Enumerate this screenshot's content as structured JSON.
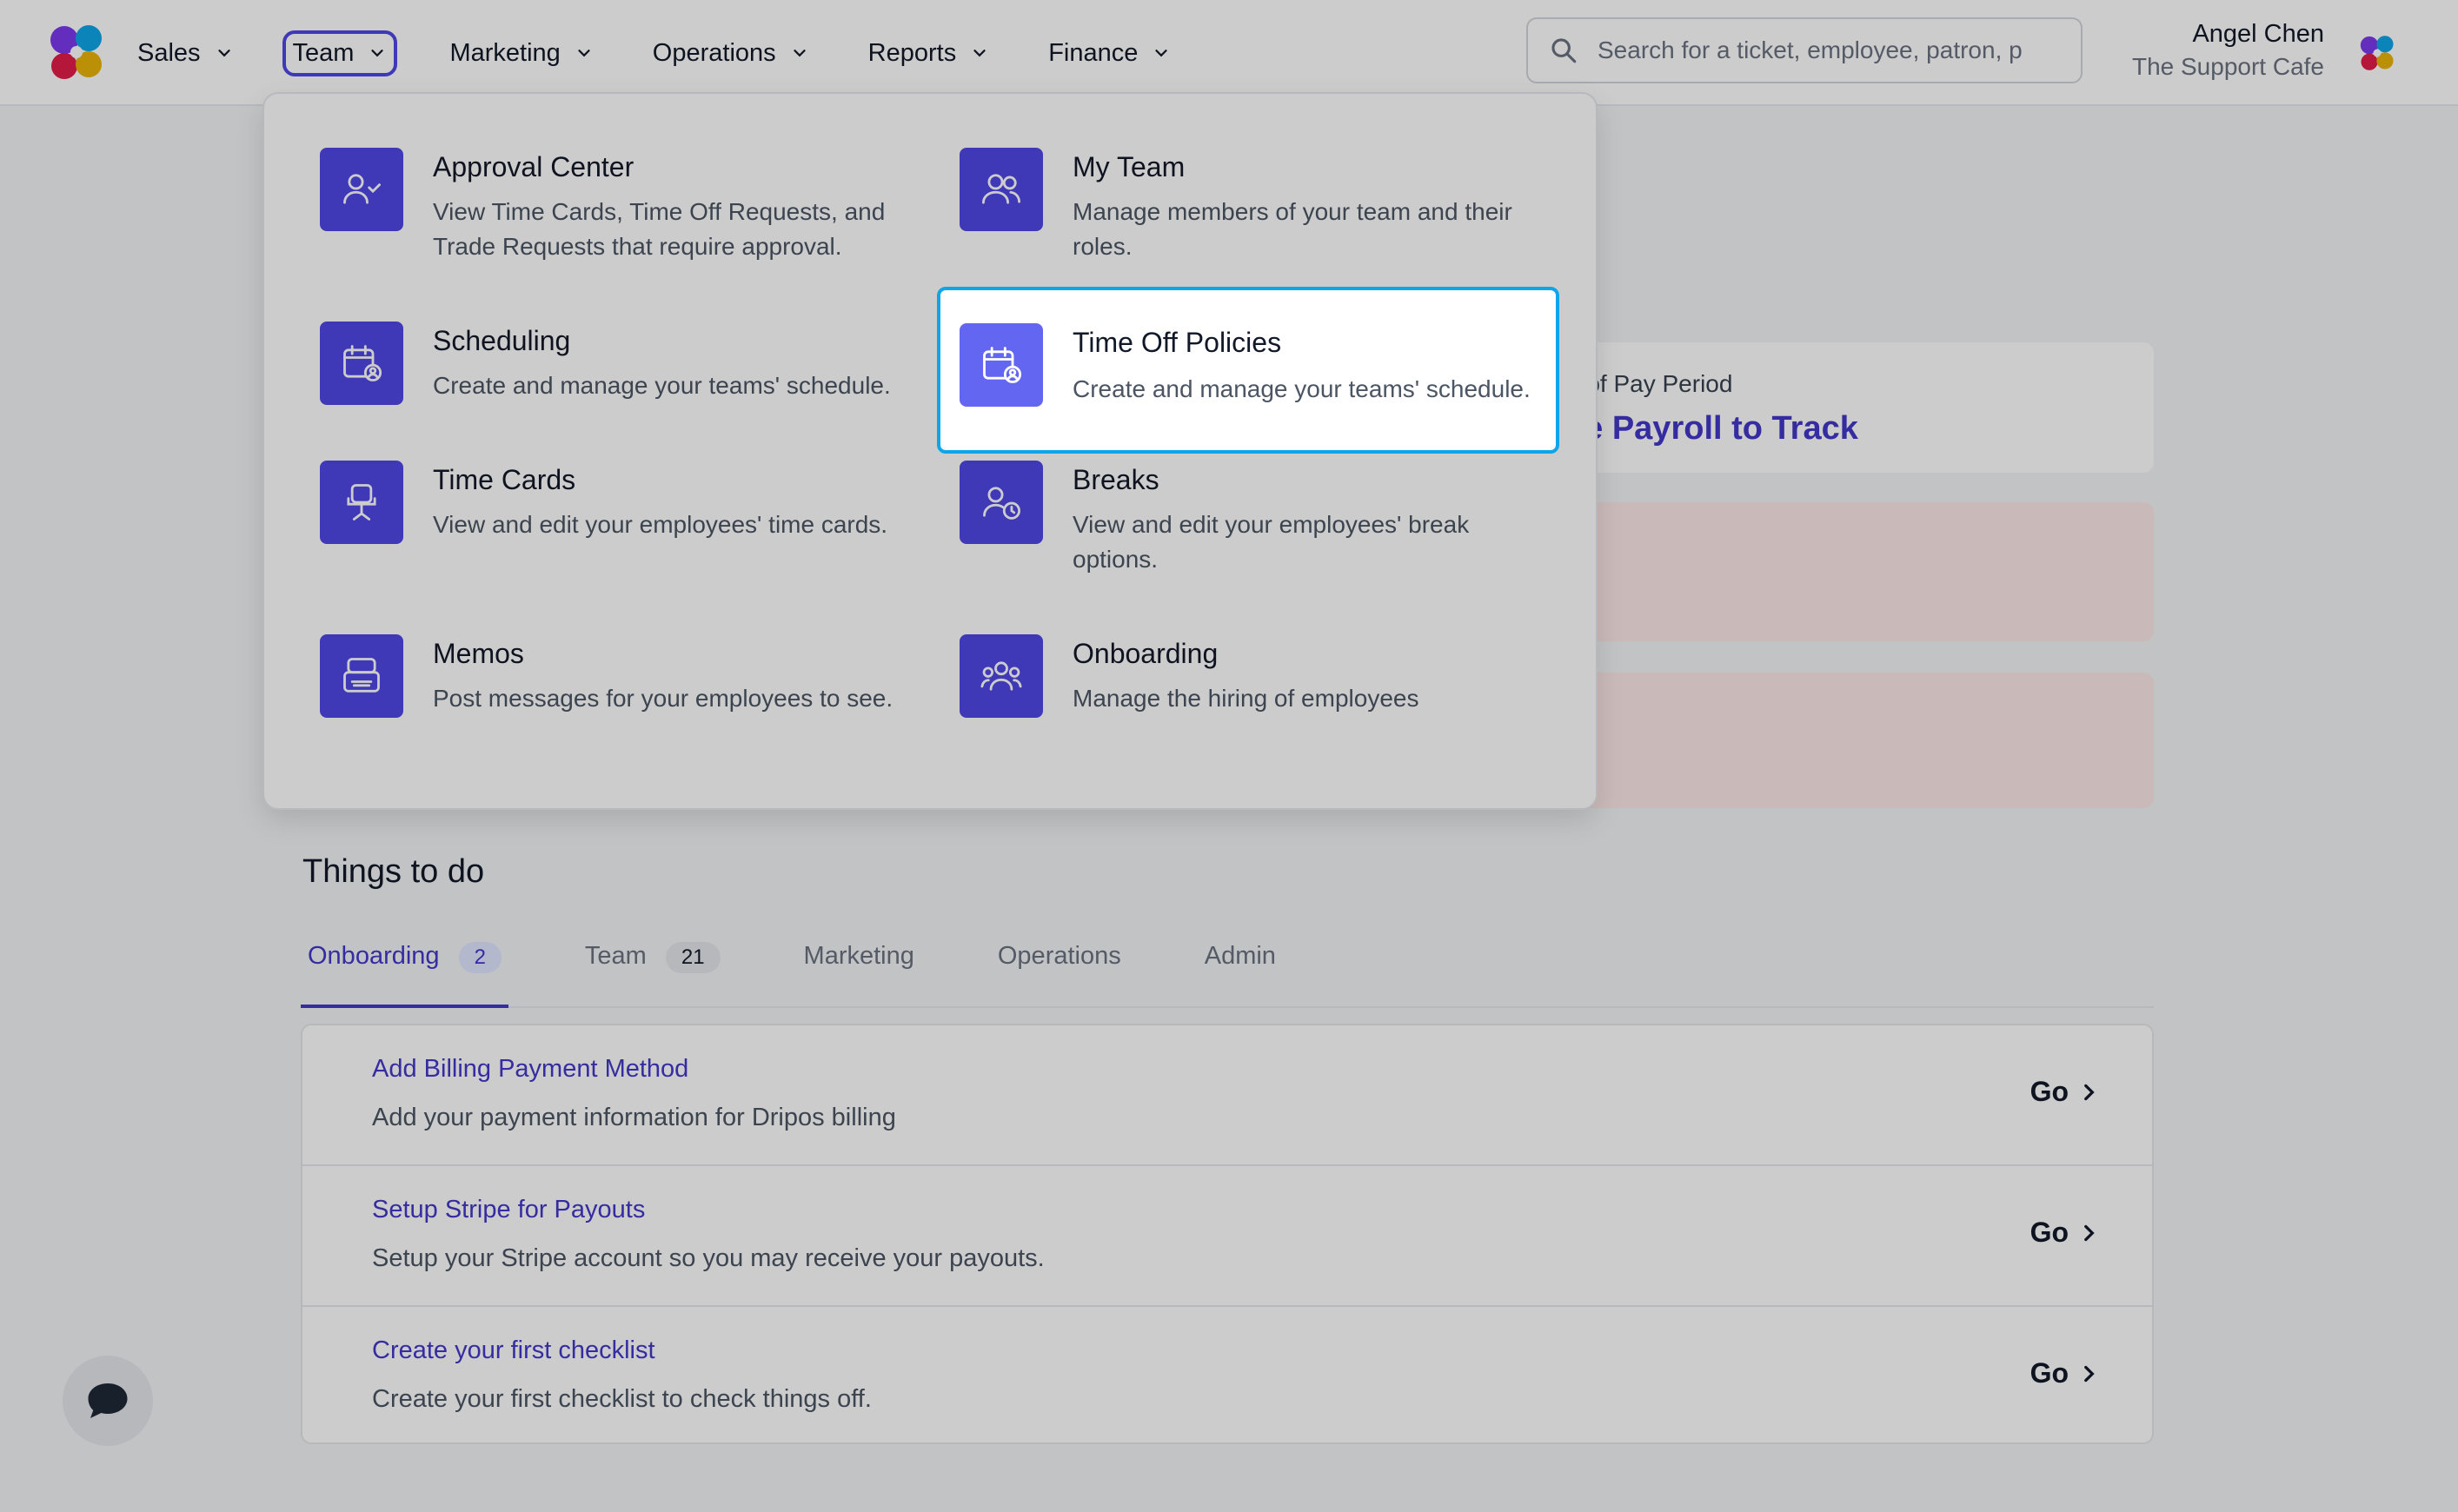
{
  "nav": {
    "items": [
      {
        "label": "Sales"
      },
      {
        "label": "Team",
        "active": true
      },
      {
        "label": "Marketing"
      },
      {
        "label": "Operations"
      },
      {
        "label": "Reports"
      },
      {
        "label": "Finance"
      }
    ]
  },
  "search": {
    "placeholder": "Search for a ticket, employee, patron, p"
  },
  "user": {
    "name": "Angel Chen",
    "org": "The Support Cafe"
  },
  "team_menu": {
    "items": [
      {
        "title": "Approval Center",
        "description": "View Time Cards, Time Off Requests, and Trade Requests that require approval.",
        "icon": "user-check-icon"
      },
      {
        "title": "My Team",
        "description": "Manage members of your team and their roles.",
        "icon": "users-icon"
      },
      {
        "title": "Scheduling",
        "description": "Create and manage your teams' schedule.",
        "icon": "calendar-user-icon"
      },
      {
        "title": "Time Off Policies",
        "description": "Create and manage your teams' schedule.",
        "icon": "calendar-user-icon",
        "highlighted": true
      },
      {
        "title": "Time Cards",
        "description": "View and edit your employees' time cards.",
        "icon": "chair-icon"
      },
      {
        "title": "Breaks",
        "description": "View and edit your employees' break options.",
        "icon": "user-clock-icon"
      },
      {
        "title": "Memos",
        "description": "Post messages for your employees to see.",
        "icon": "inbox-icon"
      },
      {
        "title": "Onboarding",
        "description": "Manage the hiring of employees",
        "icon": "users-group-icon"
      }
    ]
  },
  "pay_card": {
    "label": "d of Pay Period",
    "value": "se Payroll to Track"
  },
  "things_to_do": {
    "title": "Things to do",
    "tabs": [
      {
        "label": "Onboarding",
        "count": "2",
        "active": true
      },
      {
        "label": "Team",
        "count": "21"
      },
      {
        "label": "Marketing"
      },
      {
        "label": "Operations"
      },
      {
        "label": "Admin"
      }
    ],
    "tasks": [
      {
        "title": "Add Billing Payment Method",
        "description": "Add your payment information for Dripos billing",
        "action": "Go"
      },
      {
        "title": "Setup Stripe for Payouts",
        "description": "Setup your Stripe account so you may receive your payouts.",
        "action": "Go"
      },
      {
        "title": "Create your first checklist",
        "description": "Create your first checklist to check things off.",
        "action": "Go"
      }
    ]
  },
  "colors": {
    "accent": "#4f46e5",
    "link": "#4338ca",
    "highlight_border": "#0ea5e9",
    "alert_bg": "#fde8e8"
  }
}
